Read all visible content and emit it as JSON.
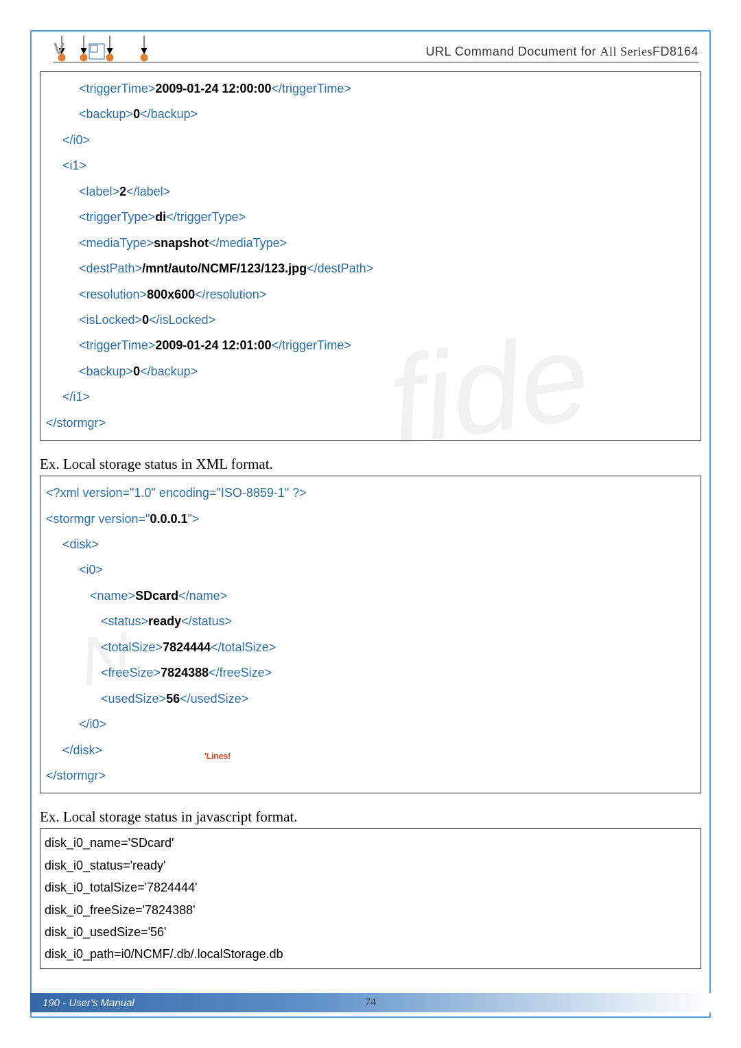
{
  "header": {
    "title_prefix": "URL Command Document for ",
    "title_series": "All Series",
    "model": "FD8164"
  },
  "box1": {
    "triggerTime_i0": "2009-01-24 12:00:00",
    "backup_i0": "0",
    "label_i1": "2",
    "triggerType_i1": "di",
    "mediaType_i1": "snapshot",
    "destPath_i1": "/mnt/auto/NCMF/123/123.jpg",
    "resolution_i1": "800x600",
    "isLocked_i1": "0",
    "triggerTime_i1": "2009-01-24 12:01:00",
    "backup_i1": "0"
  },
  "section2_label": "Ex. Local storage status in XML format.",
  "box2": {
    "xml_decl": "<?xml version=\"1.0\" encoding=\"ISO-8859-1\" ?>",
    "stormgr_version": "0.0.0.1",
    "name": "SDcard",
    "status": "ready",
    "totalSize": "7824444",
    "freeSize": "7824388",
    "usedSize": "56"
  },
  "section3_label": "Ex. Local storage status in javascript format.",
  "box3": {
    "l1": "disk_i0_name='SDcard'",
    "l2": "disk_i0_status='ready'",
    "l3": "disk_i0_totalSize='7824444'",
    "l4": "disk_i0_freeSize='7824388'",
    "l5": "disk_i0_usedSize='56'",
    "l6": "disk_i0_path=i0/NCMF/.db/.localStorage.db"
  },
  "footer": {
    "left": "190 - User's Manual",
    "center": "74"
  },
  "watermark_small": "'Lines!"
}
